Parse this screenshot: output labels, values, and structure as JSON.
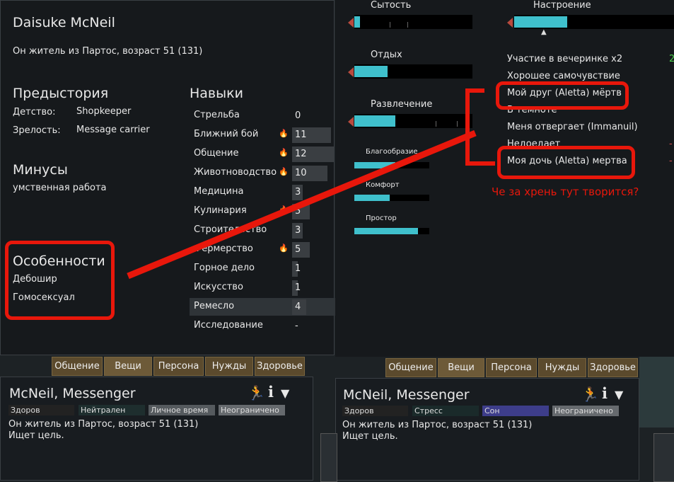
{
  "left_panel": {
    "name": "Daisuke McNeil",
    "description": "Он житель из Партос, возраст 51 (131)",
    "backstory_title": "Предыстория",
    "childhood_label": "Детство:",
    "childhood_value": "Shopkeeper",
    "adulthood_label": "Зрелость:",
    "adulthood_value": "Message carrier",
    "incapable_title": "Минусы",
    "incapable_value": "умственная работа",
    "traits_title": "Особенности",
    "traits": [
      "Дебошир",
      "Гомосексуал"
    ],
    "skills_title": "Навыки",
    "skills": [
      {
        "label": "Стрельба",
        "value": "0",
        "passion": false,
        "level": 0
      },
      {
        "label": "Ближний бой",
        "value": "11",
        "passion": true,
        "level": 11
      },
      {
        "label": "Общение",
        "value": "12",
        "passion": true,
        "level": 12
      },
      {
        "label": "Животноводство",
        "value": "10",
        "passion": true,
        "level": 10
      },
      {
        "label": "Медицина",
        "value": "3",
        "passion": false,
        "level": 3
      },
      {
        "label": "Кулинария",
        "value": "5",
        "passion": true,
        "level": 5
      },
      {
        "label": "Строительство",
        "value": "3",
        "passion": false,
        "level": 3
      },
      {
        "label": "Фермерство",
        "value": "5",
        "passion": true,
        "level": 5
      },
      {
        "label": "Горное дело",
        "value": "1",
        "passion": false,
        "level": 1
      },
      {
        "label": "Искусство",
        "value": "1",
        "passion": false,
        "level": 1
      },
      {
        "label": "Ремесло",
        "value": "4",
        "passion": false,
        "level": 4
      },
      {
        "label": "Исследование",
        "value": "-",
        "passion": false,
        "level": 0
      }
    ]
  },
  "tabs": [
    "Общение",
    "Вещи",
    "Персона",
    "Нужды",
    "Здоровье"
  ],
  "bottom_left": {
    "name": "McNeil, Messenger",
    "badges": [
      "Здоров",
      "Нейтрален",
      "Личное время",
      "Неограничено"
    ],
    "line1": "Он житель из Партос, возраст 51 (131)",
    "line2": "Ищет цель."
  },
  "bottom_right": {
    "name": "McNeil, Messenger",
    "badges": [
      "Здоров",
      "Стресс",
      "Сон",
      "Неограничено"
    ],
    "line1": "Он житель из Партос, возраст 51 (131)",
    "line2": "Ищет цель."
  },
  "needs": {
    "food": {
      "label": "Сытость",
      "level": 0.05
    },
    "rest": {
      "label": "Отдых",
      "level": 0.28
    },
    "joy": {
      "label": "Развлечение",
      "level": 0.35
    },
    "beauty": {
      "label": "Благообразие",
      "level": 0.55
    },
    "comfort": {
      "label": "Комфорт",
      "level": 0.47
    },
    "space": {
      "label": "Простор",
      "level": 0.85
    },
    "mood": {
      "label": "Настроение",
      "level": 0.33
    }
  },
  "thoughts": [
    {
      "label": "Участие в вечеринке x2",
      "value": "2"
    },
    {
      "label": "Хорошее самочувствие",
      "value": ""
    },
    {
      "label": "Мой друг (Aletta) мёртв",
      "value": ""
    },
    {
      "label": "В темноте",
      "value": ""
    },
    {
      "label": "Меня отвергает (Immanuil)",
      "value": ""
    },
    {
      "label": "Недоедает",
      "value": "-"
    },
    {
      "label": "Моя дочь (Aletta) мертва",
      "value": "-"
    }
  ],
  "annotation": "Че за хрень тут творится?",
  "icons": [
    "walk-icon",
    "info-icon",
    "dropdown-icon",
    "flame-icon",
    "arrow-left-icon"
  ],
  "colors": {
    "need_fill": "#3fc0cc",
    "annotation_red": "#e8170b",
    "tab_bg": "#5b4a2d",
    "passion": "#e6a23c"
  }
}
